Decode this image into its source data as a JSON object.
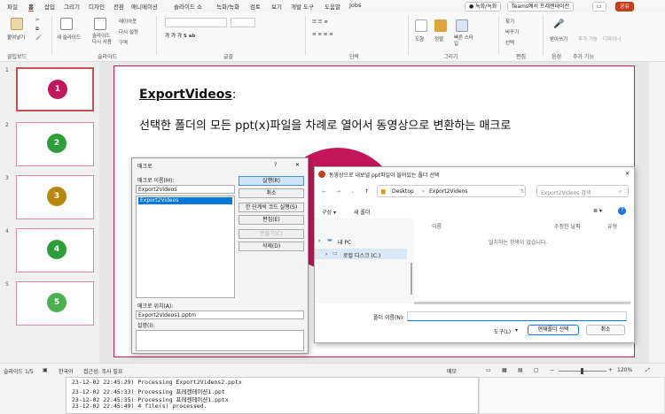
{
  "menubar": {
    "tabs": [
      "파일",
      "홈",
      "삽입",
      "그리기",
      "디자인",
      "전환",
      "애니메이션",
      "슬라이드 쇼",
      "녹화/녹화",
      "검토",
      "보기",
      "개발 도구",
      "도움말",
      "Jobs"
    ],
    "active_tab": "홈",
    "record_btn": "● 녹화/녹화",
    "teams_btn": "Teams에서 프레젠테이션",
    "share_btn": "공유"
  },
  "ribbon": {
    "paste": "붙여넣기",
    "new_slide": "새 슬라이드",
    "reuse_slide": "슬라이드 다시 사용",
    "layout": "레이아웃",
    "reset": "다시 설정",
    "section": "구역",
    "find": "찾기",
    "replace": "바꾸기",
    "select": "선택",
    "draw": "도형",
    "arrange": "정렬",
    "quick_styles": "빠른 스타일",
    "dictate": "받아쓰기",
    "addins": "추가 기능",
    "designer": "디자이너",
    "groups": [
      "클립보드",
      "슬라이드",
      "글꼴",
      "단락",
      "그리기",
      "편집",
      "음성",
      "추가 기능"
    ]
  },
  "thumbnails": [
    {
      "num": "1",
      "label": "1",
      "color": "#c2185b"
    },
    {
      "num": "2",
      "label": "2",
      "color": "#2e9e3a"
    },
    {
      "num": "3",
      "label": "3",
      "color": "#b8860b"
    },
    {
      "num": "4",
      "label": "4",
      "color": "#2e9e3a"
    },
    {
      "num": "5",
      "label": "5",
      "color": "#4caf50"
    }
  ],
  "slide": {
    "title": "ExportVideos",
    "title_suffix": " :",
    "subtitle": "선택한 폴더의 모든 ppt(x)파일을 차례로 열어서 동영상으로 변환하는 매크로"
  },
  "macro_dialog": {
    "title": "매크로",
    "help": "?",
    "close": "✕",
    "name_label": "매크로 이름(M):",
    "name_value": "Export2Videos",
    "list_item": "Export2Videos",
    "run": "실행(R)",
    "cancel": "취소",
    "step": "한 단계씩 코드 실행(S)",
    "edit": "편집(E)",
    "create": "만들기(C)",
    "delete": "삭제(D)",
    "location_label": "매크로 위치(A):",
    "location_value": "Export2Videos1.pptm",
    "desc_label": "설명(I):"
  },
  "folder_dialog": {
    "title": "동영상으로 내보낼 ppt파일이 들어있는 폴더 선택",
    "path": [
      "Desktop",
      "Export2Videos"
    ],
    "search_placeholder": "Export2Videos 검색",
    "organize": "구성 ▾",
    "new_folder": "새 폴더",
    "col_name": "이름",
    "col_date": "수정한 날짜",
    "col_type": "유형",
    "empty": "일치하는 항목이 없습니다.",
    "tree_pc": "내 PC",
    "tree_disk": "로컬 디스크 (C:)",
    "folder_label": "폴더 이름(N):",
    "tools": "도구(L)",
    "select_btn": "현재폴더 선택",
    "cancel_btn": "취소"
  },
  "status": {
    "slide_info": "슬라이드 1/5",
    "language": "한국어",
    "accessibility": "접근성: 조사 필요",
    "notes": "메모",
    "zoom": "120%"
  },
  "console": {
    "lines": [
      "23-12-02 22:45:29) Processing Export2Videos2.pptx",
      "23-12-02 22:45:33) Processing 프레젠테이션1.ppt",
      "23-12-02 22:45:35) Processing 프레젠테이션1.pptx",
      "23-12-02 22:45:49) 4 file(s) processed."
    ]
  },
  "colors": {
    "accent": "#c43e1c",
    "slide_border": "#d4145a"
  }
}
